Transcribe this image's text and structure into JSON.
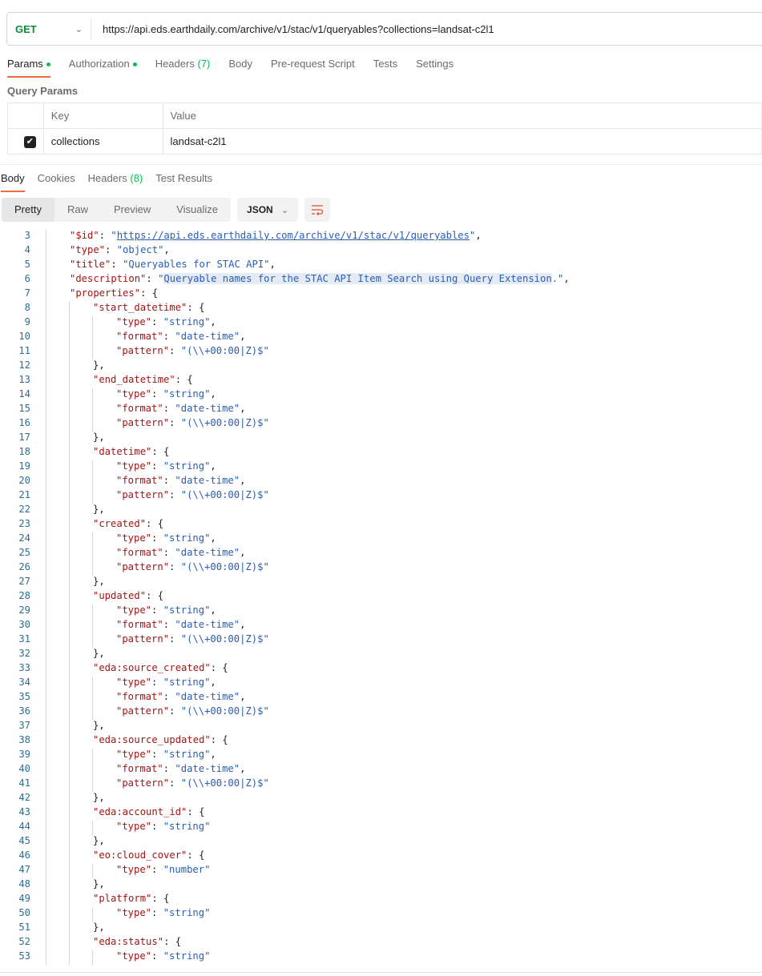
{
  "request": {
    "method": "GET",
    "url": "https://api.eds.earthdaily.com/archive/v1/stac/v1/queryables?collections=landsat-c2l1"
  },
  "request_tabs": [
    {
      "label": "Params",
      "dot": true,
      "active": true
    },
    {
      "label": "Authorization",
      "dot": true
    },
    {
      "label": "Headers",
      "count": "(7)"
    },
    {
      "label": "Body"
    },
    {
      "label": "Pre-request Script"
    },
    {
      "label": "Tests"
    },
    {
      "label": "Settings"
    }
  ],
  "query_params": {
    "title": "Query Params",
    "headers": {
      "key": "Key",
      "value": "Value"
    },
    "rows": [
      {
        "checked": true,
        "key": "collections",
        "value": "landsat-c2l1"
      }
    ]
  },
  "response_tabs": [
    {
      "label": "Body",
      "active": true
    },
    {
      "label": "Cookies"
    },
    {
      "label": "Headers",
      "count": "(8)"
    },
    {
      "label": "Test Results"
    }
  ],
  "view_modes": [
    "Pretty",
    "Raw",
    "Preview",
    "Visualize"
  ],
  "active_view": "Pretty",
  "format": "JSON",
  "icons": {
    "wrap": "wrap-lines-icon",
    "chevron": "chevron-down-icon",
    "check": "checkbox-checked-icon"
  },
  "code_lines": [
    {
      "n": 3,
      "indent": 1,
      "tokens": [
        [
          "k",
          "\"$id\""
        ],
        [
          "p",
          ": "
        ],
        [
          "s",
          "\""
        ],
        [
          "u",
          "https://api.eds.earthdaily.com/archive/v1/stac/v1/queryables"
        ],
        [
          "s",
          "\""
        ],
        [
          "p",
          ","
        ]
      ]
    },
    {
      "n": 4,
      "indent": 1,
      "tokens": [
        [
          "k",
          "\"type\""
        ],
        [
          "p",
          ": "
        ],
        [
          "s",
          "\"object\""
        ],
        [
          "p",
          ","
        ]
      ]
    },
    {
      "n": 5,
      "indent": 1,
      "tokens": [
        [
          "k",
          "\"title\""
        ],
        [
          "p",
          ": "
        ],
        [
          "s",
          "\"Queryables for STAC API\""
        ],
        [
          "p",
          ","
        ]
      ]
    },
    {
      "n": 6,
      "indent": 1,
      "tokens": [
        [
          "k",
          "\"description\""
        ],
        [
          "p",
          ": "
        ],
        [
          "s",
          "\""
        ],
        [
          "hl",
          "Queryable names for the STAC API Item Search using Query Extension"
        ],
        [
          "s",
          ".\""
        ],
        [
          "p",
          ","
        ]
      ]
    },
    {
      "n": 7,
      "indent": 1,
      "tokens": [
        [
          "k",
          "\"properties\""
        ],
        [
          "p",
          ": {"
        ]
      ]
    },
    {
      "n": 8,
      "indent": 2,
      "tokens": [
        [
          "k",
          "\"start_datetime\""
        ],
        [
          "p",
          ": {"
        ]
      ]
    },
    {
      "n": 9,
      "indent": 3,
      "tokens": [
        [
          "k",
          "\"type\""
        ],
        [
          "p",
          ": "
        ],
        [
          "s",
          "\"string\""
        ],
        [
          "p",
          ","
        ]
      ]
    },
    {
      "n": 10,
      "indent": 3,
      "tokens": [
        [
          "k",
          "\"format\""
        ],
        [
          "p",
          ": "
        ],
        [
          "s",
          "\"date-time\""
        ],
        [
          "p",
          ","
        ]
      ]
    },
    {
      "n": 11,
      "indent": 3,
      "tokens": [
        [
          "k",
          "\"pattern\""
        ],
        [
          "p",
          ": "
        ],
        [
          "s",
          "\"(\\\\+00:00|Z)$\""
        ]
      ]
    },
    {
      "n": 12,
      "indent": 2,
      "tokens": [
        [
          "p",
          "},"
        ]
      ]
    },
    {
      "n": 13,
      "indent": 2,
      "tokens": [
        [
          "k",
          "\"end_datetime\""
        ],
        [
          "p",
          ": {"
        ]
      ]
    },
    {
      "n": 14,
      "indent": 3,
      "tokens": [
        [
          "k",
          "\"type\""
        ],
        [
          "p",
          ": "
        ],
        [
          "s",
          "\"string\""
        ],
        [
          "p",
          ","
        ]
      ]
    },
    {
      "n": 15,
      "indent": 3,
      "tokens": [
        [
          "k",
          "\"format\""
        ],
        [
          "p",
          ": "
        ],
        [
          "s",
          "\"date-time\""
        ],
        [
          "p",
          ","
        ]
      ]
    },
    {
      "n": 16,
      "indent": 3,
      "tokens": [
        [
          "k",
          "\"pattern\""
        ],
        [
          "p",
          ": "
        ],
        [
          "s",
          "\"(\\\\+00:00|Z)$\""
        ]
      ]
    },
    {
      "n": 17,
      "indent": 2,
      "tokens": [
        [
          "p",
          "},"
        ]
      ]
    },
    {
      "n": 18,
      "indent": 2,
      "tokens": [
        [
          "k",
          "\"datetime\""
        ],
        [
          "p",
          ": {"
        ]
      ]
    },
    {
      "n": 19,
      "indent": 3,
      "tokens": [
        [
          "k",
          "\"type\""
        ],
        [
          "p",
          ": "
        ],
        [
          "s",
          "\"string\""
        ],
        [
          "p",
          ","
        ]
      ]
    },
    {
      "n": 20,
      "indent": 3,
      "tokens": [
        [
          "k",
          "\"format\""
        ],
        [
          "p",
          ": "
        ],
        [
          "s",
          "\"date-time\""
        ],
        [
          "p",
          ","
        ]
      ]
    },
    {
      "n": 21,
      "indent": 3,
      "tokens": [
        [
          "k",
          "\"pattern\""
        ],
        [
          "p",
          ": "
        ],
        [
          "s",
          "\"(\\\\+00:00|Z)$\""
        ]
      ]
    },
    {
      "n": 22,
      "indent": 2,
      "tokens": [
        [
          "p",
          "},"
        ]
      ]
    },
    {
      "n": 23,
      "indent": 2,
      "tokens": [
        [
          "k",
          "\"created\""
        ],
        [
          "p",
          ": {"
        ]
      ]
    },
    {
      "n": 24,
      "indent": 3,
      "tokens": [
        [
          "k",
          "\"type\""
        ],
        [
          "p",
          ": "
        ],
        [
          "s",
          "\"string\""
        ],
        [
          "p",
          ","
        ]
      ]
    },
    {
      "n": 25,
      "indent": 3,
      "tokens": [
        [
          "k",
          "\"format\""
        ],
        [
          "p",
          ": "
        ],
        [
          "s",
          "\"date-time\""
        ],
        [
          "p",
          ","
        ]
      ]
    },
    {
      "n": 26,
      "indent": 3,
      "tokens": [
        [
          "k",
          "\"pattern\""
        ],
        [
          "p",
          ": "
        ],
        [
          "s",
          "\"(\\\\+00:00|Z)$\""
        ]
      ]
    },
    {
      "n": 27,
      "indent": 2,
      "tokens": [
        [
          "p",
          "},"
        ]
      ]
    },
    {
      "n": 28,
      "indent": 2,
      "tokens": [
        [
          "k",
          "\"updated\""
        ],
        [
          "p",
          ": {"
        ]
      ]
    },
    {
      "n": 29,
      "indent": 3,
      "tokens": [
        [
          "k",
          "\"type\""
        ],
        [
          "p",
          ": "
        ],
        [
          "s",
          "\"string\""
        ],
        [
          "p",
          ","
        ]
      ]
    },
    {
      "n": 30,
      "indent": 3,
      "tokens": [
        [
          "k",
          "\"format\""
        ],
        [
          "p",
          ": "
        ],
        [
          "s",
          "\"date-time\""
        ],
        [
          "p",
          ","
        ]
      ]
    },
    {
      "n": 31,
      "indent": 3,
      "tokens": [
        [
          "k",
          "\"pattern\""
        ],
        [
          "p",
          ": "
        ],
        [
          "s",
          "\"(\\\\+00:00|Z)$\""
        ]
      ]
    },
    {
      "n": 32,
      "indent": 2,
      "tokens": [
        [
          "p",
          "},"
        ]
      ]
    },
    {
      "n": 33,
      "indent": 2,
      "tokens": [
        [
          "k",
          "\"eda:source_created\""
        ],
        [
          "p",
          ": {"
        ]
      ]
    },
    {
      "n": 34,
      "indent": 3,
      "tokens": [
        [
          "k",
          "\"type\""
        ],
        [
          "p",
          ": "
        ],
        [
          "s",
          "\"string\""
        ],
        [
          "p",
          ","
        ]
      ]
    },
    {
      "n": 35,
      "indent": 3,
      "tokens": [
        [
          "k",
          "\"format\""
        ],
        [
          "p",
          ": "
        ],
        [
          "s",
          "\"date-time\""
        ],
        [
          "p",
          ","
        ]
      ]
    },
    {
      "n": 36,
      "indent": 3,
      "tokens": [
        [
          "k",
          "\"pattern\""
        ],
        [
          "p",
          ": "
        ],
        [
          "s",
          "\"(\\\\+00:00|Z)$\""
        ]
      ]
    },
    {
      "n": 37,
      "indent": 2,
      "tokens": [
        [
          "p",
          "},"
        ]
      ]
    },
    {
      "n": 38,
      "indent": 2,
      "tokens": [
        [
          "k",
          "\"eda:source_updated\""
        ],
        [
          "p",
          ": {"
        ]
      ]
    },
    {
      "n": 39,
      "indent": 3,
      "tokens": [
        [
          "k",
          "\"type\""
        ],
        [
          "p",
          ": "
        ],
        [
          "s",
          "\"string\""
        ],
        [
          "p",
          ","
        ]
      ]
    },
    {
      "n": 40,
      "indent": 3,
      "tokens": [
        [
          "k",
          "\"format\""
        ],
        [
          "p",
          ": "
        ],
        [
          "s",
          "\"date-time\""
        ],
        [
          "p",
          ","
        ]
      ]
    },
    {
      "n": 41,
      "indent": 3,
      "tokens": [
        [
          "k",
          "\"pattern\""
        ],
        [
          "p",
          ": "
        ],
        [
          "s",
          "\"(\\\\+00:00|Z)$\""
        ]
      ]
    },
    {
      "n": 42,
      "indent": 2,
      "tokens": [
        [
          "p",
          "},"
        ]
      ]
    },
    {
      "n": 43,
      "indent": 2,
      "tokens": [
        [
          "k",
          "\"eda:account_id\""
        ],
        [
          "p",
          ": {"
        ]
      ]
    },
    {
      "n": 44,
      "indent": 3,
      "tokens": [
        [
          "k",
          "\"type\""
        ],
        [
          "p",
          ": "
        ],
        [
          "s",
          "\"string\""
        ]
      ]
    },
    {
      "n": 45,
      "indent": 2,
      "tokens": [
        [
          "p",
          "},"
        ]
      ]
    },
    {
      "n": 46,
      "indent": 2,
      "tokens": [
        [
          "k",
          "\"eo:cloud_cover\""
        ],
        [
          "p",
          ": {"
        ]
      ]
    },
    {
      "n": 47,
      "indent": 3,
      "tokens": [
        [
          "k",
          "\"type\""
        ],
        [
          "p",
          ": "
        ],
        [
          "s",
          "\"number\""
        ]
      ]
    },
    {
      "n": 48,
      "indent": 2,
      "tokens": [
        [
          "p",
          "},"
        ]
      ]
    },
    {
      "n": 49,
      "indent": 2,
      "tokens": [
        [
          "k",
          "\"platform\""
        ],
        [
          "p",
          ": {"
        ]
      ]
    },
    {
      "n": 50,
      "indent": 3,
      "tokens": [
        [
          "k",
          "\"type\""
        ],
        [
          "p",
          ": "
        ],
        [
          "s",
          "\"string\""
        ]
      ]
    },
    {
      "n": 51,
      "indent": 2,
      "tokens": [
        [
          "p",
          "},"
        ]
      ]
    },
    {
      "n": 52,
      "indent": 2,
      "tokens": [
        [
          "k",
          "\"eda:status\""
        ],
        [
          "p",
          ": {"
        ]
      ]
    },
    {
      "n": 53,
      "indent": 3,
      "tokens": [
        [
          "k",
          "\"type\""
        ],
        [
          "p",
          ": "
        ],
        [
          "s",
          "\"string\""
        ]
      ]
    }
  ]
}
